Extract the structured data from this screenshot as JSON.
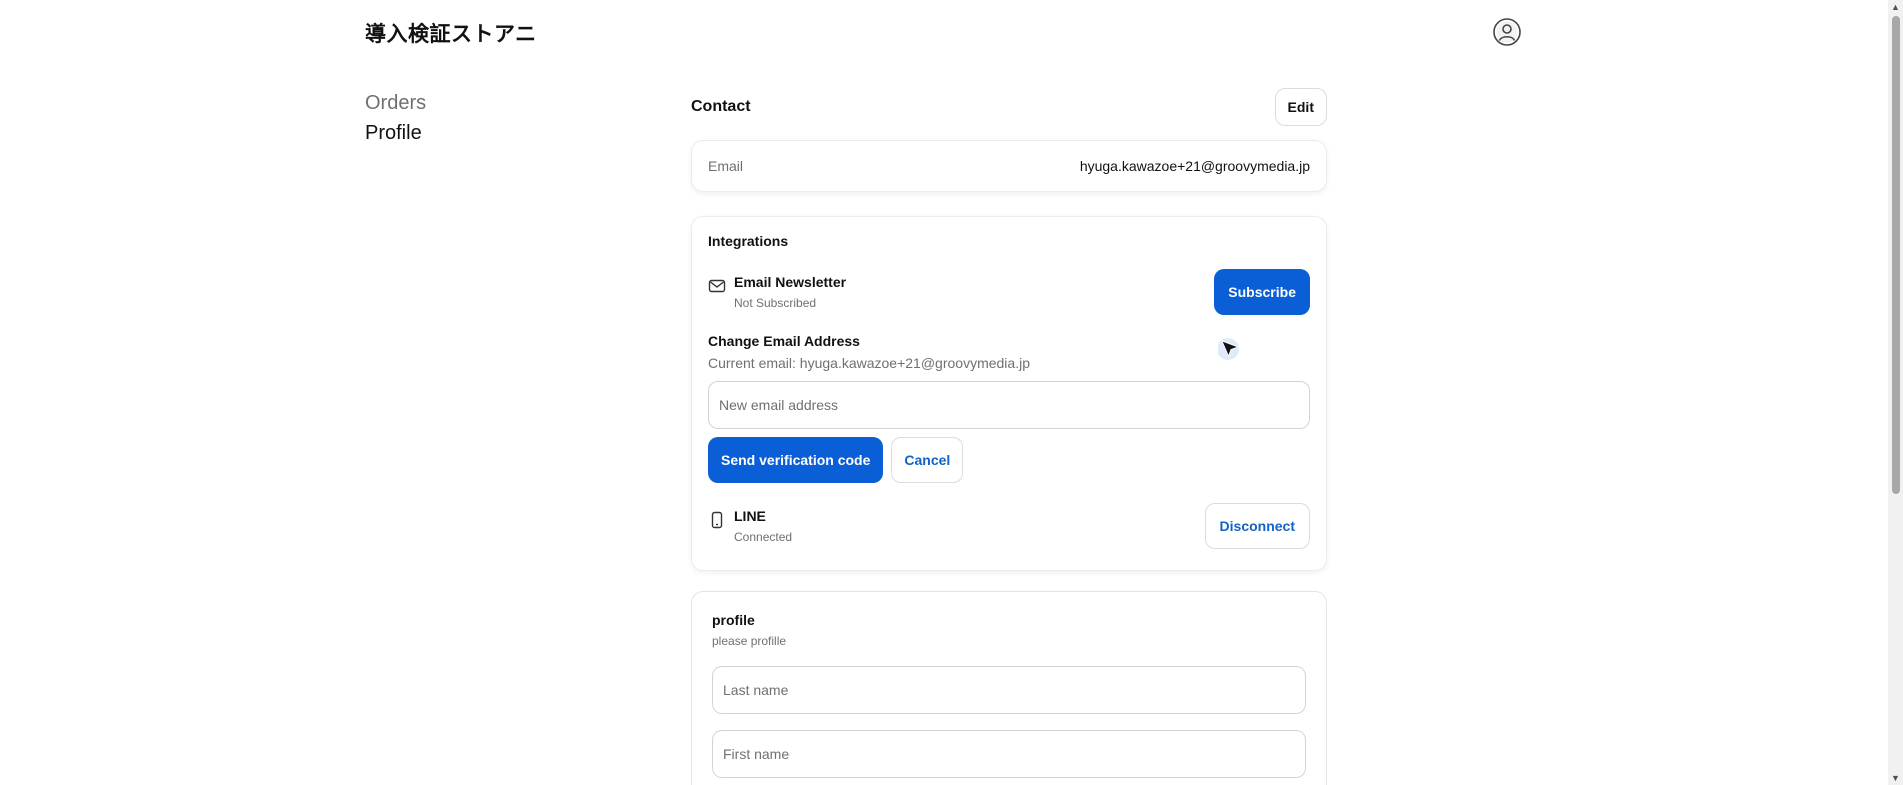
{
  "header": {
    "store_name": "導入検証ストアニ"
  },
  "nav": {
    "orders": "Orders",
    "profile": "Profile"
  },
  "contact": {
    "title": "Contact",
    "edit_label": "Edit",
    "email_label": "Email",
    "email_value": "hyuga.kawazoe+21@groovymedia.jp"
  },
  "integrations": {
    "title": "Integrations",
    "newsletter": {
      "name": "Email Newsletter",
      "status": "Not Subscribed",
      "button": "Subscribe",
      "icon": "mail-icon"
    },
    "change_email": {
      "title": "Change Email Address",
      "current": "Current email: hyuga.kawazoe+21@groovymedia.jp",
      "placeholder": "New email address",
      "send_label": "Send verification code",
      "cancel_label": "Cancel"
    },
    "line": {
      "name": "LINE",
      "status": "Connected",
      "button": "Disconnect",
      "icon": "mobile-phone-icon"
    }
  },
  "profile_form": {
    "title": "profile",
    "subtitle": "please profille",
    "last_name_placeholder": "Last name",
    "first_name_placeholder": "First name"
  },
  "colors": {
    "primary": "#0a5fd6",
    "link": "#1462c5",
    "muted": "#707070"
  }
}
